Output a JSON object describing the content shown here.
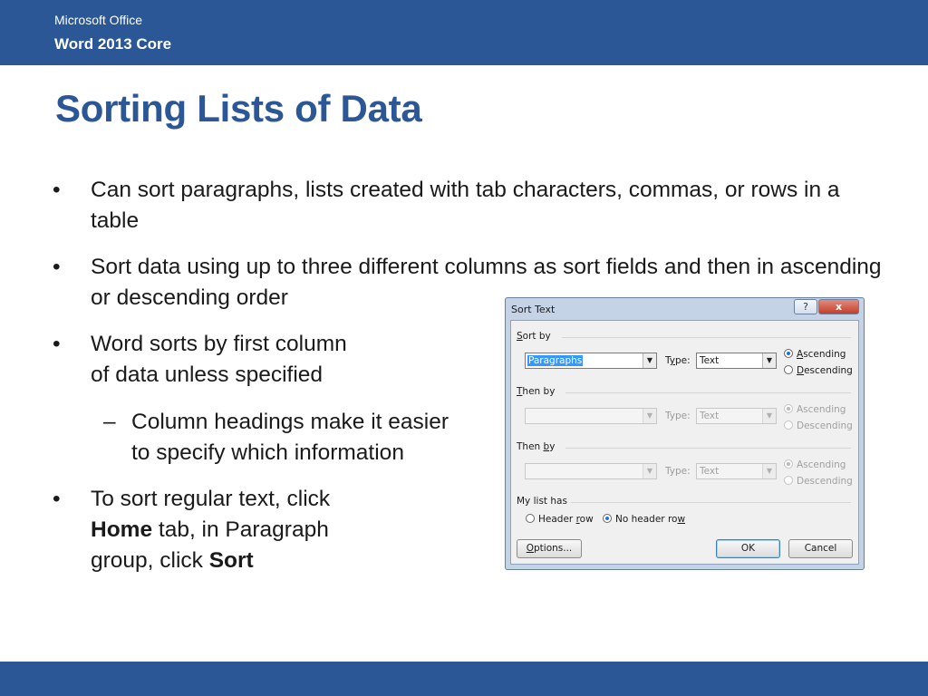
{
  "header": {
    "line1": "Microsoft Office",
    "line2": "Word 2013 Core"
  },
  "slide": {
    "title": "Sorting Lists of Data",
    "bullet_char": "•",
    "dash_char": "–",
    "bullets": [
      {
        "text": "Can sort paragraphs, lists created with tab characters, commas, or rows in a table"
      },
      {
        "text": "Sort data using up to three different columns as sort fields and then in ascending or descending order"
      },
      {
        "line1": "Word sorts by first column",
        "line2": "of data unless specified"
      },
      {
        "line1": "Column headings make it easier",
        "line2": "to specify which information"
      },
      {
        "line1": "To sort regular text, click",
        "bold1": "Home",
        "line2_rest": " tab, in Paragraph",
        "line3_pre": "group, click ",
        "bold2": "Sort"
      }
    ]
  },
  "dialog": {
    "title": "Sort Text",
    "help_label": "?",
    "close_label": "x",
    "sort_by": {
      "label_pre": "",
      "label_u": "S",
      "label_post": "ort by",
      "value": "Paragraphs",
      "type_label_pre": "T",
      "type_label_u": "y",
      "type_label_post": "pe:",
      "type_value": "Text",
      "ascending_pre": "",
      "ascending_u": "A",
      "ascending_post": "scending",
      "descending_pre": "",
      "descending_u": "D",
      "descending_post": "escending",
      "selected": "ascending"
    },
    "then_by_1": {
      "label_pre": "",
      "label_u": "T",
      "label_post": "hen by",
      "value": "",
      "type_label": "Type:",
      "type_value": "Text",
      "ascending": "Ascending",
      "descending": "Descending",
      "selected": "ascending"
    },
    "then_by_2": {
      "label_pre": "Then ",
      "label_u": "b",
      "label_post": "y",
      "value": "",
      "type_label": "Type:",
      "type_value": "Text",
      "ascending": "Ascending",
      "descending": "Descending",
      "selected": "ascending"
    },
    "my_list_has": {
      "label": "My list has",
      "header_row_pre": "Header ",
      "header_row_u": "r",
      "header_row_post": "ow",
      "no_header_row_pre": "No header ro",
      "no_header_row_u": "w",
      "no_header_row_post": "",
      "selected": "no_header_row"
    },
    "buttons": {
      "options_pre": "",
      "options_u": "O",
      "options_post": "ptions...",
      "ok": "OK",
      "cancel": "Cancel"
    }
  }
}
